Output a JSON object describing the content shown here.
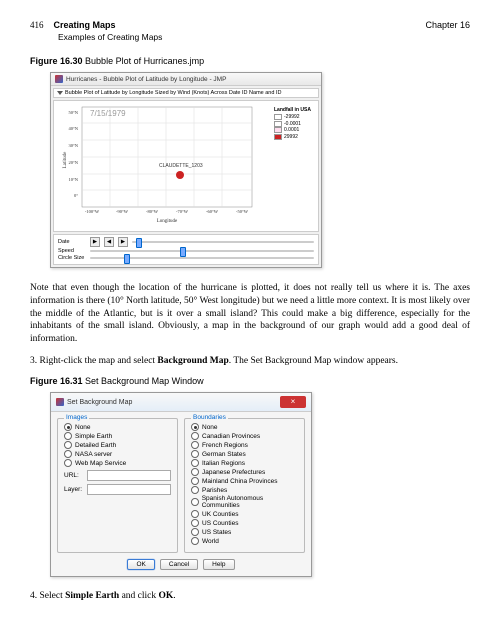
{
  "header": {
    "page_number": "416",
    "title": "Creating Maps",
    "chapter": "Chapter 16",
    "subtitle": "Examples of Creating Maps"
  },
  "figure1": {
    "label_prefix": "Figure 16.30",
    "label_text": "Bubble Plot of Hurricanes.jmp",
    "window_title": "Hurricanes - Bubble Plot of Latitude by Longitude - JMP",
    "plot_title": "Bubble Plot of Latitude by Longitude Sized by Wind (Knots) Across Date ID Name and ID",
    "date_label": "7/15/1979",
    "point_label": "CLAUDETTE_1203",
    "y_label": "Latitude",
    "x_label": "Longitude",
    "y_ticks": [
      "50°N",
      "40°N",
      "30°N",
      "20°N",
      "10°N",
      "0°"
    ],
    "x_ticks": [
      "-100°W",
      "-90°W",
      "-80°W",
      "-70°W",
      "-60°W",
      "-50°W"
    ],
    "legend_title": "Landfall in USA",
    "legend_items": [
      {
        "label": "-29992",
        "color": "#fff"
      },
      {
        "label": "-0.0001",
        "color": "#fff"
      },
      {
        "label": "0.0001",
        "color": "#fde"
      },
      {
        "label": "29992",
        "color": "#c22"
      }
    ],
    "controls": {
      "date_label": "Date",
      "speed_label": "Speed",
      "circle_label": "Circle Size"
    }
  },
  "chart_data": {
    "type": "scatter",
    "title": "Bubble Plot of Latitude by Longitude Sized by Wind (Knots) Across Date ID Name and ID",
    "xlabel": "Longitude",
    "ylabel": "Latitude",
    "xlim": [
      "-100°W",
      "-50°W"
    ],
    "ylim": [
      "0°",
      "50°N"
    ],
    "series": [
      {
        "name": "CLAUDETTE_1203",
        "x": [
          -65
        ],
        "y": [
          17
        ],
        "color": "#c22"
      }
    ]
  },
  "paragraph1": "Note that even though the location of the hurricane is plotted, it does not really tell us where it is. The axes information is there (10° North latitude, 50° West longitude) but we need a little more context. It is most likely over the middle of the Atlantic, but is it over a small island? This could make a big difference, especially for the inhabitants of the small island. Obviously, a map in the background of our graph would add a good deal of information.",
  "step3": {
    "num": "3.",
    "text_a": "Right-click the map and select ",
    "bold": "Background Map",
    "text_b": ". The Set Background Map window appears."
  },
  "figure2": {
    "label_prefix": "Figure 16.31",
    "label_text": "Set Background Map Window",
    "window_title": "Set Background Map",
    "close": "×",
    "images_title": "Images",
    "images_options": [
      "None",
      "Simple Earth",
      "Detailed Earth",
      "NASA server",
      "Web Map Service"
    ],
    "images_checked": "None",
    "url_label": "URL:",
    "layer_label": "Layer:",
    "boundaries_title": "Boundaries",
    "boundaries_options": [
      "None",
      "Canadian Provinces",
      "French Regions",
      "German States",
      "Italian Regions",
      "Japanese Prefectures",
      "Mainland China Provinces",
      "Parishes",
      "Spanish Autonomous Communities",
      "UK Counties",
      "US Counties",
      "US States",
      "World"
    ],
    "boundaries_checked": "None",
    "ok": "OK",
    "cancel": "Cancel",
    "help": "Help"
  },
  "step4": {
    "num": "4.",
    "text_a": "Select ",
    "bold1": "Simple Earth",
    "text_b": " and click ",
    "bold2": "OK",
    "text_c": "."
  }
}
